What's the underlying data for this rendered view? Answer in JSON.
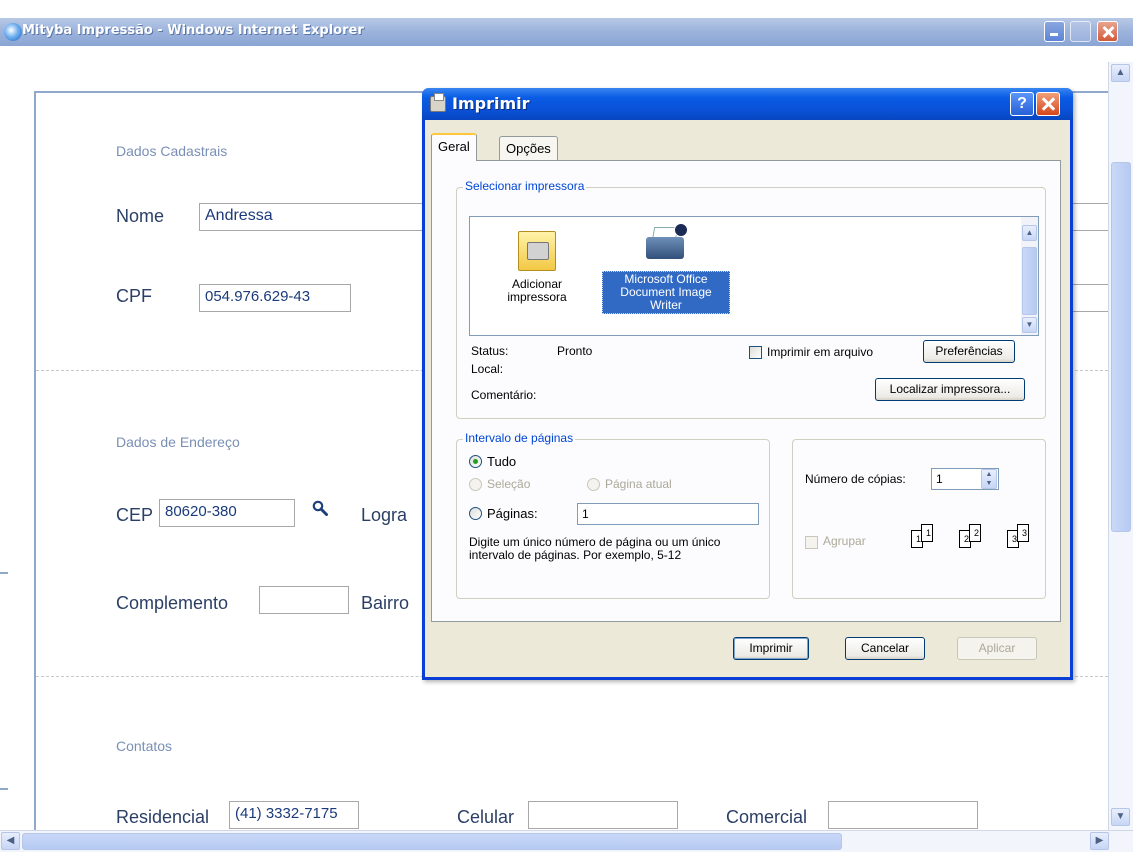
{
  "browser": {
    "window_title": "Mityba Impressão - Windows Internet Explorer"
  },
  "form": {
    "section_dados": "Dados Cadastrais",
    "nome_label": "Nome",
    "nome_value": "Andressa",
    "cpf_label": "CPF",
    "cpf_value": "054.976.629-43",
    "section_endereco": "Dados de Endereço",
    "cep_label": "CEP",
    "cep_value": "80620-380",
    "logradouro_label": "Logra",
    "complemento_label": "Complemento",
    "complemento_value": "",
    "bairro_label": "Bairro",
    "section_contatos": "Contatos",
    "residencial_label": "Residencial",
    "residencial_value": "(41) 3332-7175",
    "celular_label": "Celular",
    "celular_value": "",
    "comercial_label": "Comercial",
    "comercial_value": ""
  },
  "dialog": {
    "title": "Imprimir",
    "help_label": "?",
    "tabs": [
      {
        "label": "Geral"
      },
      {
        "label": "Opções"
      }
    ],
    "printer_group_label": "Selecionar impressora",
    "printers": [
      {
        "name": "Adicionar impressora",
        "icon": "add-printer-icon"
      },
      {
        "name": "Microsoft Office Document Image Writer",
        "icon": "printer-icon"
      }
    ],
    "status_label": "Status:",
    "status_value": "Pronto",
    "local_label": "Local:",
    "comentario_label": "Comentário:",
    "print_to_file_label": "Imprimir em arquivo",
    "preferences_label": "Preferências",
    "find_printer_label": "Localizar impressora...",
    "page_range_group_label": "Intervalo de páginas",
    "range_all": "Tudo",
    "range_selection": "Seleção",
    "range_current": "Página atual",
    "range_pages": "Páginas:",
    "pages_value": "1",
    "range_hint": "Digite um único número de página ou um único intervalo de páginas. Por exemplo, 5-12",
    "copies_label": "Número de cópias:",
    "copies_value": "1",
    "collate_label": "Agrupar",
    "collate_pages": [
      "1",
      "1",
      "2",
      "2",
      "3",
      "3"
    ],
    "print_button": "Imprimir",
    "cancel_button": "Cancelar",
    "apply_button": "Aplicar"
  },
  "colors": {
    "dialog_title": "#0a50d6",
    "group_label": "#0046d5",
    "section_title": "#7a8fb5",
    "form_label": "#2b3f66"
  }
}
